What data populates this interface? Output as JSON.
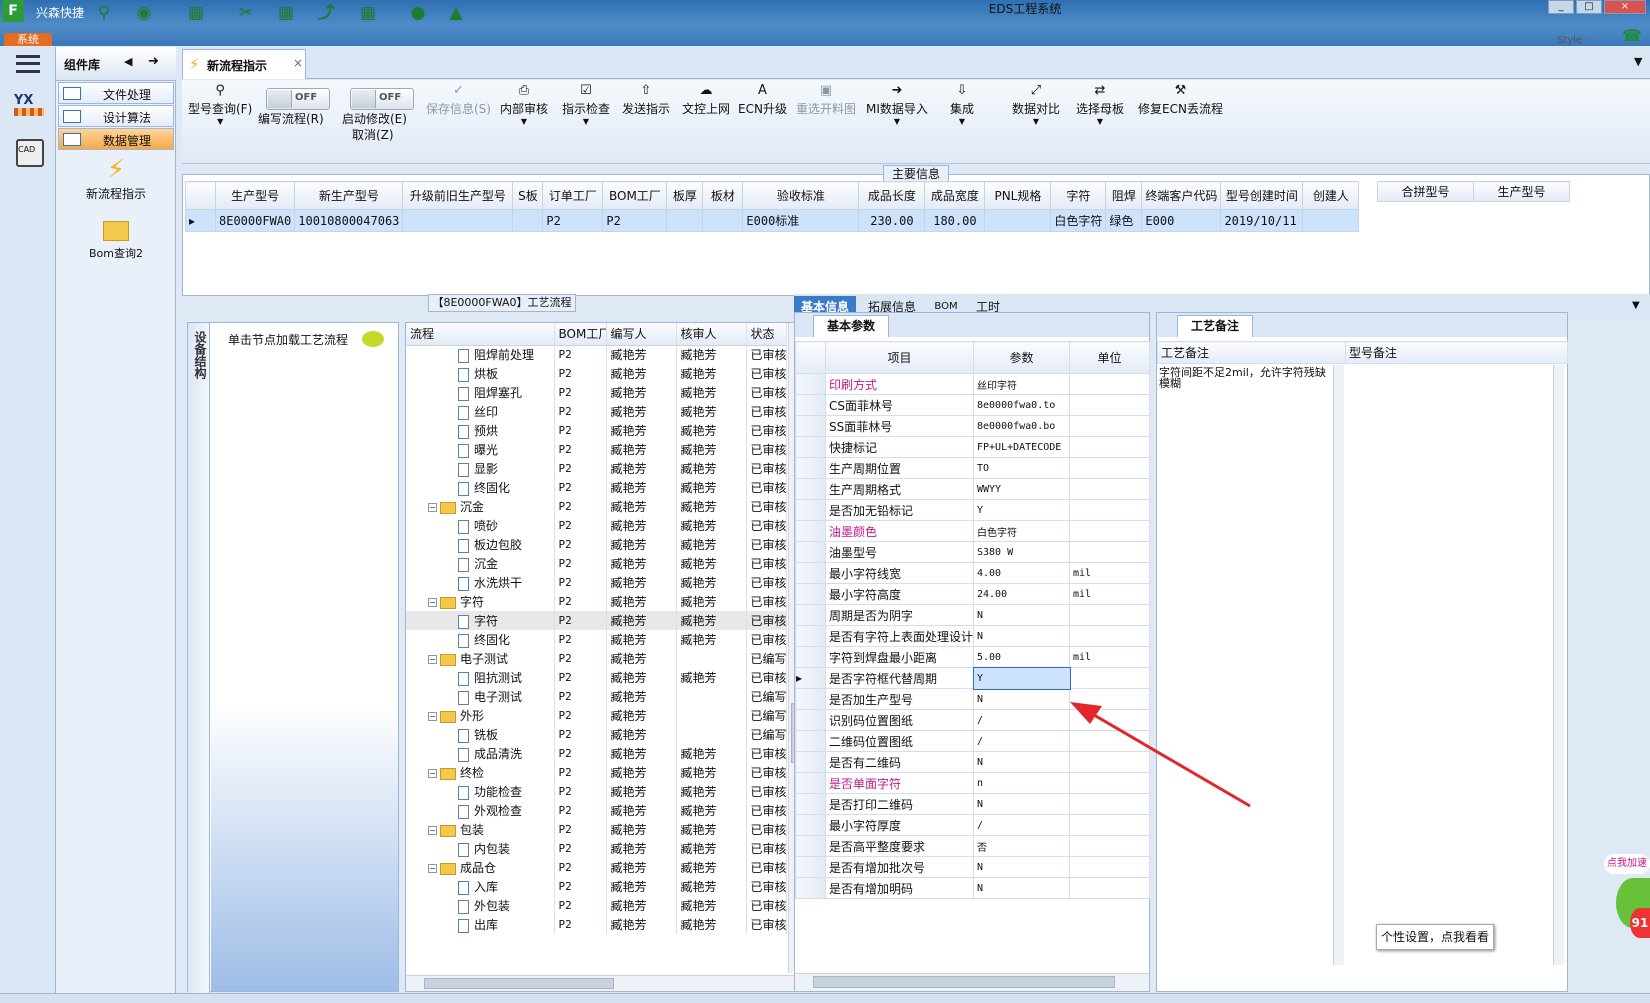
{
  "app": {
    "name": "兴森快捷",
    "title": "EDS工程系统",
    "system_tab": "系统",
    "style_label": "Style ·",
    "toolbar_icons": [
      "search-icon",
      "globe-icon",
      "grid-icon",
      "scissors-icon",
      "table-icon",
      "chart-icon",
      "grid2-icon",
      "user-icon",
      "area-chart-icon"
    ]
  },
  "side_strip": {
    "yx_label": "YX",
    "calc_label": "CAD"
  },
  "component_panel": {
    "title": "组件库",
    "items": [
      {
        "label": "文件处理",
        "active": false
      },
      {
        "label": "设计算法",
        "active": false
      },
      {
        "label": "数据管理",
        "active": true
      }
    ],
    "shortcuts": [
      {
        "label": "新流程指示",
        "icon": "lightning-icon"
      },
      {
        "label": "Bom查询2",
        "icon": "folder-icon"
      }
    ]
  },
  "document_tab": {
    "label": "新流程指示",
    "close": "×"
  },
  "toolbar": {
    "model_query": "型号查询(F)",
    "edit_flow": "编写流程(R)",
    "edit_flow_toggle": "OFF",
    "auto_modify": "启动修改(E)",
    "auto_modify_toggle": "OFF",
    "cancel": "取消(Z)",
    "save_info": "保存信息(S)",
    "internal_review": "内部审核",
    "instruction_check": "指示检查",
    "send_instruction": "发送指示",
    "upload_doc": "文控上网",
    "ecn_upgrade": "ECN升级",
    "reselect_layout": "重选开料图",
    "mi_import": "MI数据导入",
    "integrate": "集成",
    "data_compare": "数据对比",
    "select_master": "选择母板",
    "repair_ecn": "修复ECN丢流程"
  },
  "main_info": {
    "legend": "主要信息",
    "columns": [
      "生产型号",
      "新生产型号",
      "升级前旧生产型号",
      "S板",
      "订单工厂",
      "BOM工厂",
      "板厚",
      "板材",
      "验收标准",
      "成品长度",
      "成品宽度",
      "PNL规格",
      "字符",
      "阻焊",
      "终端客户代码",
      "型号创建时间",
      "创建人"
    ],
    "rows": [
      [
        "8E0000FWA0",
        "10010800047063",
        "",
        "",
        "P2",
        "P2",
        "",
        "",
        "E000标准",
        "230.00",
        "180.00",
        "",
        "白色字符",
        "绿色",
        "E000",
        "2019/10/11",
        ""
      ]
    ],
    "side_columns": [
      "合拼型号",
      "生产型号"
    ]
  },
  "device_tree": {
    "vertical_tab": "设备结构",
    "hint": "单击节点加载工艺流程"
  },
  "flow": {
    "title": "【8E0000FWA0】工艺流程",
    "columns": [
      "流程",
      "BOM工厂",
      "编写人",
      "核审人",
      "状态"
    ],
    "rows": [
      {
        "name": "阻焊前处理",
        "level": 2,
        "factory": "P2",
        "writer": "臧艳芳",
        "reviewer": "臧艳芳",
        "status": "已审核"
      },
      {
        "name": "烘板",
        "level": 2,
        "factory": "P2",
        "writer": "臧艳芳",
        "reviewer": "臧艳芳",
        "status": "已审核"
      },
      {
        "name": "阻焊塞孔",
        "level": 2,
        "factory": "P2",
        "writer": "臧艳芳",
        "reviewer": "臧艳芳",
        "status": "已审核"
      },
      {
        "name": "丝印",
        "level": 2,
        "factory": "P2",
        "writer": "臧艳芳",
        "reviewer": "臧艳芳",
        "status": "已审核"
      },
      {
        "name": "预烘",
        "level": 2,
        "factory": "P2",
        "writer": "臧艳芳",
        "reviewer": "臧艳芳",
        "status": "已审核"
      },
      {
        "name": "曝光",
        "level": 2,
        "factory": "P2",
        "writer": "臧艳芳",
        "reviewer": "臧艳芳",
        "status": "已审核"
      },
      {
        "name": "显影",
        "level": 2,
        "factory": "P2",
        "writer": "臧艳芳",
        "reviewer": "臧艳芳",
        "status": "已审核"
      },
      {
        "name": "终固化",
        "level": 2,
        "factory": "P2",
        "writer": "臧艳芳",
        "reviewer": "臧艳芳",
        "status": "已审核"
      },
      {
        "name": "沉金",
        "level": 1,
        "factory": "P2",
        "writer": "臧艳芳",
        "reviewer": "臧艳芳",
        "status": "已审核"
      },
      {
        "name": "喷砂",
        "level": 2,
        "factory": "P2",
        "writer": "臧艳芳",
        "reviewer": "臧艳芳",
        "status": "已审核"
      },
      {
        "name": "板边包胶",
        "level": 2,
        "factory": "P2",
        "writer": "臧艳芳",
        "reviewer": "臧艳芳",
        "status": "已审核"
      },
      {
        "name": "沉金",
        "level": 2,
        "factory": "P2",
        "writer": "臧艳芳",
        "reviewer": "臧艳芳",
        "status": "已审核"
      },
      {
        "name": "水洗烘干",
        "level": 2,
        "factory": "P2",
        "writer": "臧艳芳",
        "reviewer": "臧艳芳",
        "status": "已审核"
      },
      {
        "name": "字符",
        "level": 1,
        "factory": "P2",
        "writer": "臧艳芳",
        "reviewer": "臧艳芳",
        "status": "已审核"
      },
      {
        "name": "字符",
        "level": 2,
        "factory": "P2",
        "writer": "臧艳芳",
        "reviewer": "臧艳芳",
        "status": "已审核"
      },
      {
        "name": "终固化",
        "level": 2,
        "factory": "P2",
        "writer": "臧艳芳",
        "reviewer": "臧艳芳",
        "status": "已审核"
      },
      {
        "name": "电子测试",
        "level": 1,
        "factory": "P2",
        "writer": "臧艳芳",
        "reviewer": "",
        "status": "已编写"
      },
      {
        "name": "阻抗测试",
        "level": 2,
        "factory": "P2",
        "writer": "臧艳芳",
        "reviewer": "臧艳芳",
        "status": "已审核"
      },
      {
        "name": "电子测试",
        "level": 2,
        "factory": "P2",
        "writer": "臧艳芳",
        "reviewer": "",
        "status": "已编写"
      },
      {
        "name": "外形",
        "level": 1,
        "factory": "P2",
        "writer": "臧艳芳",
        "reviewer": "",
        "status": "已编写"
      },
      {
        "name": "铣板",
        "level": 2,
        "factory": "P2",
        "writer": "臧艳芳",
        "reviewer": "",
        "status": "已编写"
      },
      {
        "name": "成品清洗",
        "level": 2,
        "factory": "P2",
        "writer": "臧艳芳",
        "reviewer": "臧艳芳",
        "status": "已审核"
      },
      {
        "name": "终检",
        "level": 1,
        "factory": "P2",
        "writer": "臧艳芳",
        "reviewer": "臧艳芳",
        "status": "已审核"
      },
      {
        "name": "功能检查",
        "level": 2,
        "factory": "P2",
        "writer": "臧艳芳",
        "reviewer": "臧艳芳",
        "status": "已审核"
      },
      {
        "name": "外观检查",
        "level": 2,
        "factory": "P2",
        "writer": "臧艳芳",
        "reviewer": "臧艳芳",
        "status": "已审核"
      },
      {
        "name": "包装",
        "level": 1,
        "factory": "P2",
        "writer": "臧艳芳",
        "reviewer": "臧艳芳",
        "status": "已审核"
      },
      {
        "name": "内包装",
        "level": 2,
        "factory": "P2",
        "writer": "臧艳芳",
        "reviewer": "臧艳芳",
        "status": "已审核"
      },
      {
        "name": "成品仓",
        "level": 1,
        "factory": "P2",
        "writer": "臧艳芳",
        "reviewer": "臧艳芳",
        "status": "已审核"
      },
      {
        "name": "入库",
        "level": 2,
        "factory": "P2",
        "writer": "臧艳芳",
        "reviewer": "臧艳芳",
        "status": "已审核"
      },
      {
        "name": "外包装",
        "level": 2,
        "factory": "P2",
        "writer": "臧艳芳",
        "reviewer": "臧艳芳",
        "status": "已审核"
      },
      {
        "name": "出库",
        "level": 2,
        "factory": "P2",
        "writer": "臧艳芳",
        "reviewer": "臧艳芳",
        "status": "已审核"
      }
    ]
  },
  "right_tabs": [
    "基本信息",
    "拓展信息",
    "BOM",
    "工时"
  ],
  "basic_params": {
    "title": "基本参数",
    "columns": [
      "项目",
      "参数",
      "单位"
    ],
    "rows": [
      {
        "item": "印刷方式",
        "value": "丝印字符",
        "unit": "",
        "pink": true
      },
      {
        "item": "CS面菲林号",
        "value": "8e0000fwa0.to",
        "unit": "",
        "pink": false
      },
      {
        "item": "SS面菲林号",
        "value": "8e0000fwa0.bo",
        "unit": "",
        "pink": false
      },
      {
        "item": "快捷标记",
        "value": "FP+UL+DATECODE",
        "unit": "",
        "pink": false
      },
      {
        "item": "生产周期位置",
        "value": "TO",
        "unit": "",
        "pink": false
      },
      {
        "item": "生产周期格式",
        "value": "WWYY",
        "unit": "",
        "pink": false
      },
      {
        "item": "是否加无铅标记",
        "value": "Y",
        "unit": "",
        "pink": false
      },
      {
        "item": "油墨颜色",
        "value": "白色字符",
        "unit": "",
        "pink": true
      },
      {
        "item": "油墨型号",
        "value": "S380 W",
        "unit": "",
        "pink": false
      },
      {
        "item": "最小字符线宽",
        "value": "4.00",
        "unit": "mil",
        "pink": false
      },
      {
        "item": "最小字符高度",
        "value": "24.00",
        "unit": "mil",
        "pink": false
      },
      {
        "item": "周期是否为阴字",
        "value": "N",
        "unit": "",
        "pink": false
      },
      {
        "item": "是否有字符上表面处理设计",
        "value": "N",
        "unit": "",
        "pink": false
      },
      {
        "item": "字符到焊盘最小距离",
        "value": "5.00",
        "unit": "mil",
        "pink": false
      },
      {
        "item": "是否字符框代替周期",
        "value": "Y",
        "unit": "",
        "pink": false,
        "current": true
      },
      {
        "item": "是否加生产型号",
        "value": "N",
        "unit": "",
        "pink": false
      },
      {
        "item": "识别码位置图纸",
        "value": "/",
        "unit": "",
        "pink": false
      },
      {
        "item": "二维码位置图纸",
        "value": "/",
        "unit": "",
        "pink": false
      },
      {
        "item": "是否有二维码",
        "value": "N",
        "unit": "",
        "pink": false
      },
      {
        "item": "是否单面字符",
        "value": "n",
        "unit": "",
        "pink": true
      },
      {
        "item": "是否打印二维码",
        "value": "N",
        "unit": "",
        "pink": false
      },
      {
        "item": "最小字符厚度",
        "value": "/",
        "unit": "",
        "pink": false
      },
      {
        "item": "是否高平整度要求",
        "value": "否",
        "unit": "",
        "pink": false
      },
      {
        "item": "是否有增加批次号",
        "value": "N",
        "unit": "",
        "pink": false
      },
      {
        "item": "是否有增加明码",
        "value": "N",
        "unit": "",
        "pink": false
      }
    ]
  },
  "remarks": {
    "title": "工艺备注",
    "columns": [
      "工艺备注",
      "型号备注"
    ],
    "process_note": "字符间距不足2mil，允许字符残缺模糊",
    "model_note": ""
  },
  "widgets": {
    "promo_badge": "点我加速",
    "promo_count": "91",
    "tooltip": "个性设置，点我看看"
  }
}
